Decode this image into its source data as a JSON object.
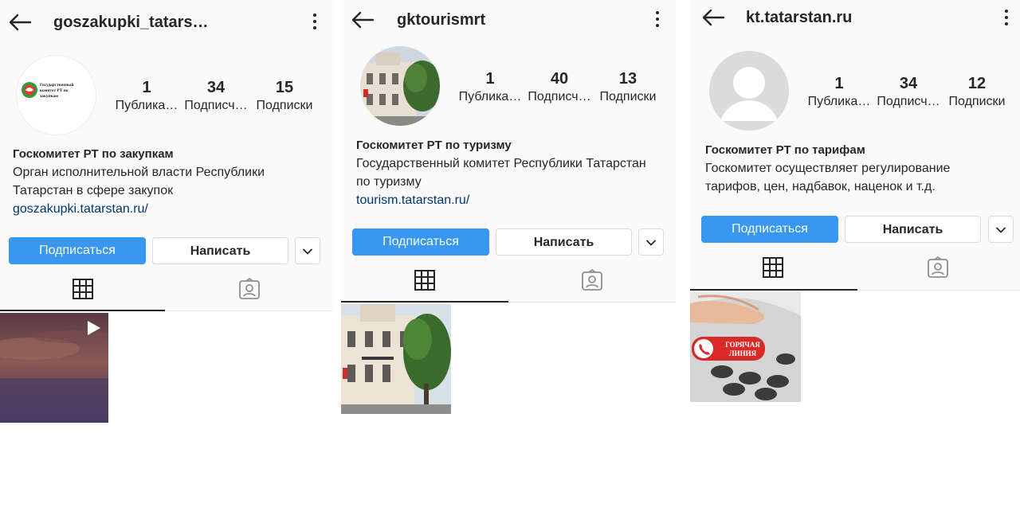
{
  "colors": {
    "accent": "#3897f0",
    "link": "#00376b"
  },
  "profiles": [
    {
      "username": "goszakupki_tatars…",
      "avatar": {
        "kind": "logo",
        "logo_text": "Государственный комитет РТ по закупкам"
      },
      "stats": [
        {
          "value": "1",
          "label": "Публика…"
        },
        {
          "value": "34",
          "label": "Подписч…"
        },
        {
          "value": "15",
          "label": "Подписки"
        }
      ],
      "name": "Госкомитет РТ по закупкам",
      "bio_lines": [
        "Орган исполнительной власти Республики",
        "Татарстан в сфере закупок"
      ],
      "link": "goszakupki.tatarstan.ru/",
      "follow_label": "Подписаться",
      "message_label": "Написать",
      "post": {
        "kind": "video",
        "icon": "play-icon"
      }
    },
    {
      "username": "gktourismrt",
      "avatar": {
        "kind": "photo"
      },
      "stats": [
        {
          "value": "1",
          "label": "Публика…"
        },
        {
          "value": "40",
          "label": "Подписч…"
        },
        {
          "value": "13",
          "label": "Подписки"
        }
      ],
      "name": "Госкомитет РТ по туризму",
      "bio_lines": [
        "Государственный комитет Республики Татарстан",
        "по туризму"
      ],
      "link": "tourism.tatarstan.ru/",
      "follow_label": "Подписаться",
      "message_label": "Написать",
      "post": {
        "kind": "photo"
      }
    },
    {
      "username": "kt.tatarstan.ru",
      "avatar": {
        "kind": "default"
      },
      "stats": [
        {
          "value": "1",
          "label": "Публика…"
        },
        {
          "value": "34",
          "label": "Подписч…"
        },
        {
          "value": "12",
          "label": "Подписки"
        }
      ],
      "name": "Госкомитет РТ по тарифам",
      "bio_lines": [
        "Госкомитет осуществляет регулирование",
        "тарифов, цен, надбавок, наценок и т.д."
      ],
      "link": "",
      "follow_label": "Подписаться",
      "message_label": "Написать",
      "post": {
        "kind": "hotline",
        "badge_line1": "ГОРЯЧАЯ",
        "badge_line2": "ЛИНИЯ"
      }
    }
  ]
}
